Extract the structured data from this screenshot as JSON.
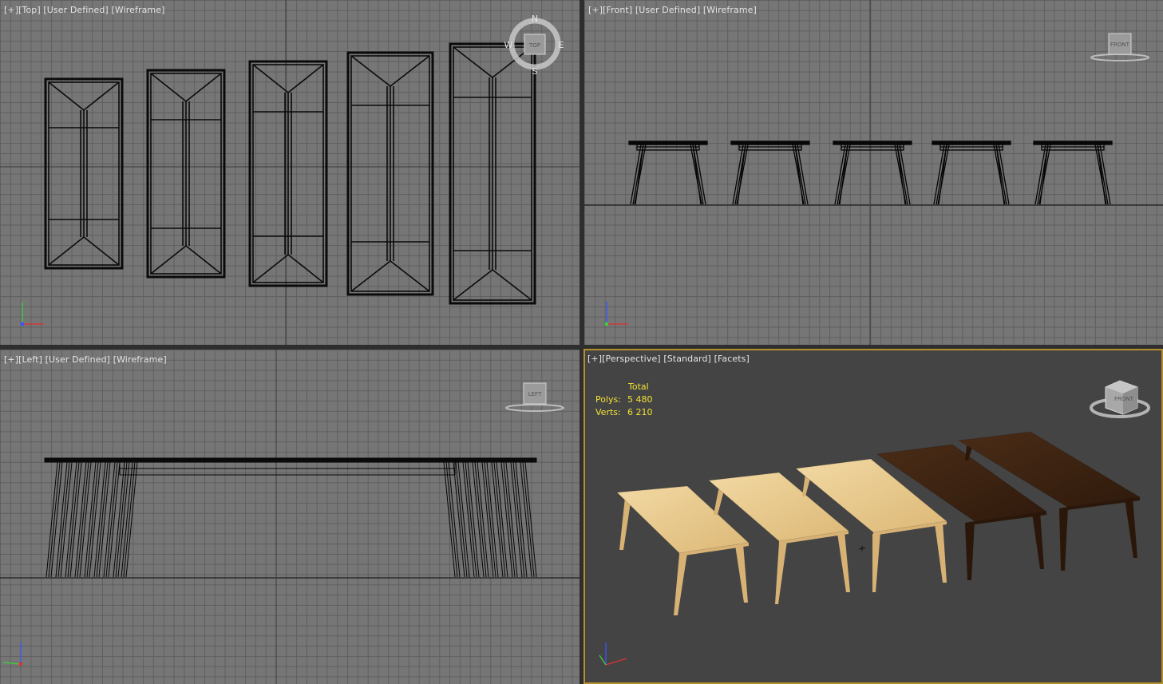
{
  "viewports": {
    "top": {
      "label": {
        "plus": "[+]",
        "view": "[Top]",
        "shading_mode": "[User Defined]",
        "render_style": "[Wireframe]"
      },
      "compass": {
        "n": "N",
        "s": "S",
        "e": "E",
        "w": "W",
        "cube_face": "TOP"
      }
    },
    "front": {
      "label": {
        "plus": "[+]",
        "view": "[Front]",
        "shading_mode": "[User Defined]",
        "render_style": "[Wireframe]"
      },
      "cube_face": "FRONT"
    },
    "left": {
      "label": {
        "plus": "[+]",
        "view": "[Left]",
        "shading_mode": "[User Defined]",
        "render_style": "[Wireframe]"
      },
      "cube_face": "LEFT"
    },
    "perspective": {
      "label": {
        "plus": "[+]",
        "view": "[Perspective]",
        "shading_mode": "[Standard]",
        "render_style": "[Facets]"
      },
      "cube_face": "FRONT",
      "stats": {
        "header": "Total",
        "polys_label": "Polys:",
        "polys_value": "5 480",
        "verts_label": "Verts:",
        "verts_value": "6 210"
      }
    }
  },
  "colors": {
    "grid_bg": "#767676",
    "grid_line": "#5f5f5f",
    "perspective_bg": "#444444",
    "active_border": "#b58f2c",
    "stats_text": "#f1e237",
    "light_wood": "#e8c98c",
    "dark_wood": "#3b2212"
  },
  "axis_icons": [
    "x-axis",
    "y-axis",
    "z-axis"
  ]
}
